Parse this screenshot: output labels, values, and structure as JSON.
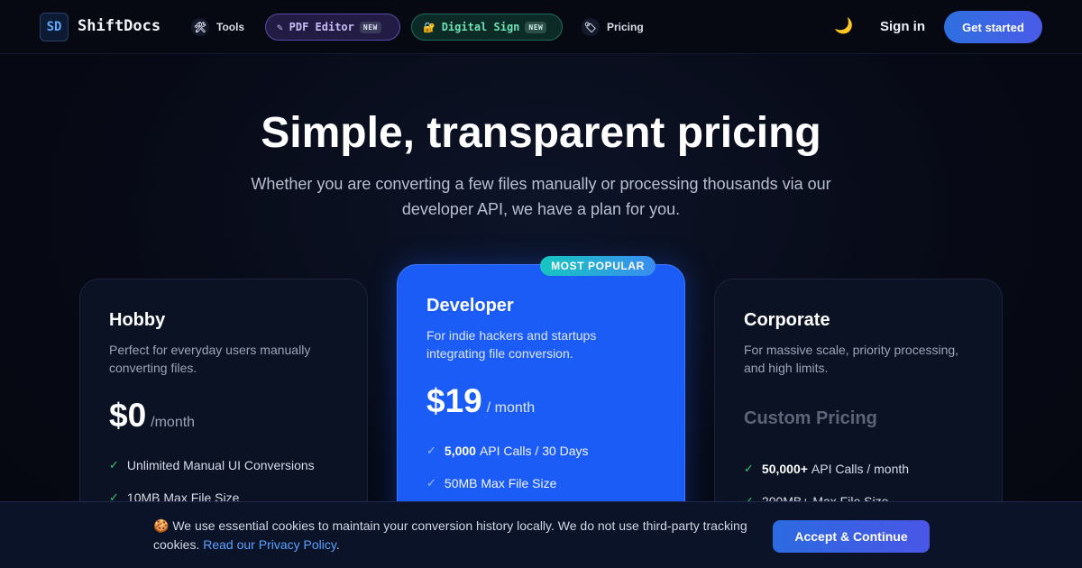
{
  "nav": {
    "logo_mark": "SD",
    "brand": "ShiftDocs",
    "tools": {
      "icon": "🛠",
      "label": "Tools"
    },
    "pdf_editor": {
      "icon": "✎",
      "label": "PDF Editor",
      "badge": "NEW"
    },
    "digital_sign": {
      "icon": "🔐",
      "label": "Digital Sign",
      "badge": "NEW"
    },
    "pricing": {
      "icon": "🏷",
      "label": "Pricing"
    },
    "theme_icon": "🌙",
    "signin": "Sign in",
    "get_started": "Get started"
  },
  "hero": {
    "title": "Simple, transparent pricing",
    "subtitle": "Whether you are converting a few files manually or processing thousands via our developer API, we have a plan for you."
  },
  "plans": {
    "hobby": {
      "name": "Hobby",
      "description": "Perfect for everyday users manually converting files.",
      "price": "$0",
      "period": "/month",
      "features": [
        {
          "bold": "",
          "text": "Unlimited Manual UI Conversions"
        },
        {
          "bold": "",
          "text": "10MB Max File Size"
        }
      ]
    },
    "developer": {
      "badge": "MOST POPULAR",
      "name": "Developer",
      "description": "For indie hackers and startups integrating file conversion.",
      "price": "$19",
      "period": "/ month",
      "features": [
        {
          "bold": "5,000",
          "text": "API Calls / 30 Days"
        },
        {
          "bold": "",
          "text": "50MB Max File Size"
        }
      ]
    },
    "corporate": {
      "name": "Corporate",
      "description": "For massive scale, priority processing, and high limits.",
      "price_label": "Custom Pricing",
      "features": [
        {
          "bold": "50,000+",
          "text": "API Calls / month"
        },
        {
          "bold": "",
          "text": "200MB+ Max File Size"
        }
      ]
    }
  },
  "cookie": {
    "icon": "🍪",
    "text": "We use essential cookies to maintain your conversion history locally. We do not use third-party tracking cookies.",
    "link": "Read our Privacy Policy",
    "end": ".",
    "accept": "Accept & Continue"
  },
  "colors": {
    "background": "#05070f",
    "accent_blue": "#1a5cf5",
    "check_green": "#2ecc71"
  }
}
